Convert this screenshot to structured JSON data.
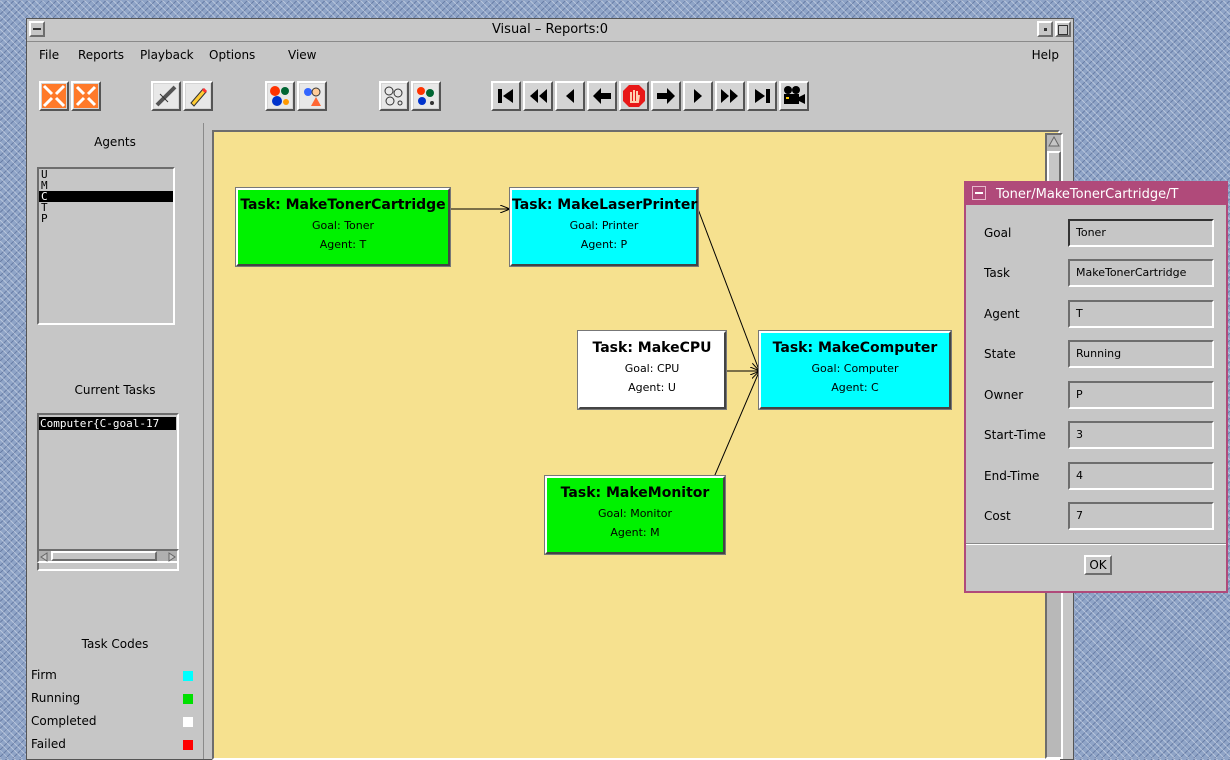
{
  "window": {
    "title": "Visual – Reports:0"
  },
  "menu": {
    "file": "File",
    "reports": "Reports",
    "playback": "Playback",
    "options": "Options",
    "view": "View",
    "help": "Help"
  },
  "left_panel": {
    "agents_heading": "Agents",
    "agents": [
      "U",
      "M",
      "C",
      "T",
      "P"
    ],
    "selected_agent": "C",
    "current_tasks_heading": "Current Tasks",
    "current_task": "Computer{C-goal-17",
    "task_codes_heading": "Task Codes",
    "codes": [
      {
        "label": "Firm",
        "color": "#00ffff"
      },
      {
        "label": "Running",
        "color": "#00e000"
      },
      {
        "label": "Completed",
        "color": "#ffffff"
      },
      {
        "label": "Failed",
        "color": "#ff0000"
      }
    ]
  },
  "nodes": [
    {
      "id": "toner",
      "title": "Task: MakeTonerCartridge",
      "goal": "Goal: Toner",
      "agent": "Agent: T",
      "status": "Running"
    },
    {
      "id": "laser",
      "title": "Task: MakeLaserPrinter",
      "goal": "Goal: Printer",
      "agent": "Agent: P",
      "status": "Firm"
    },
    {
      "id": "cpu",
      "title": "Task: MakeCPU",
      "goal": "Goal: CPU",
      "agent": "Agent: U",
      "status": "Completed"
    },
    {
      "id": "computer",
      "title": "Task: MakeComputer",
      "goal": "Goal: Computer",
      "agent": "Agent: C",
      "status": "Firm"
    },
    {
      "id": "monitor",
      "title": "Task: MakeMonitor",
      "goal": "Goal: Monitor",
      "agent": "Agent: M",
      "status": "Running"
    }
  ],
  "dialog": {
    "title": "Toner/MakeTonerCartridge/T",
    "fields": [
      {
        "label": "Goal",
        "value": "Toner"
      },
      {
        "label": "Task",
        "value": "MakeTonerCartridge"
      },
      {
        "label": "Agent",
        "value": "T"
      },
      {
        "label": "State",
        "value": "Running"
      },
      {
        "label": "Owner",
        "value": "P"
      },
      {
        "label": "Start-Time",
        "value": "3"
      },
      {
        "label": "End-Time",
        "value": "4"
      },
      {
        "label": "Cost",
        "value": "7"
      }
    ],
    "ok_label": "OK"
  },
  "toolbar_icons": [
    "collapse-icon",
    "expand-icon",
    "ruler-icon",
    "pencil-icon",
    "agents-icon",
    "agent-person-icon",
    "empty-circles-icon",
    "filled-circles-icon",
    "first-icon",
    "rewind-icon",
    "step-back-icon",
    "back-icon",
    "stop-icon",
    "forward-icon",
    "step-forward-icon",
    "fast-forward-icon",
    "last-icon",
    "camera-icon"
  ]
}
